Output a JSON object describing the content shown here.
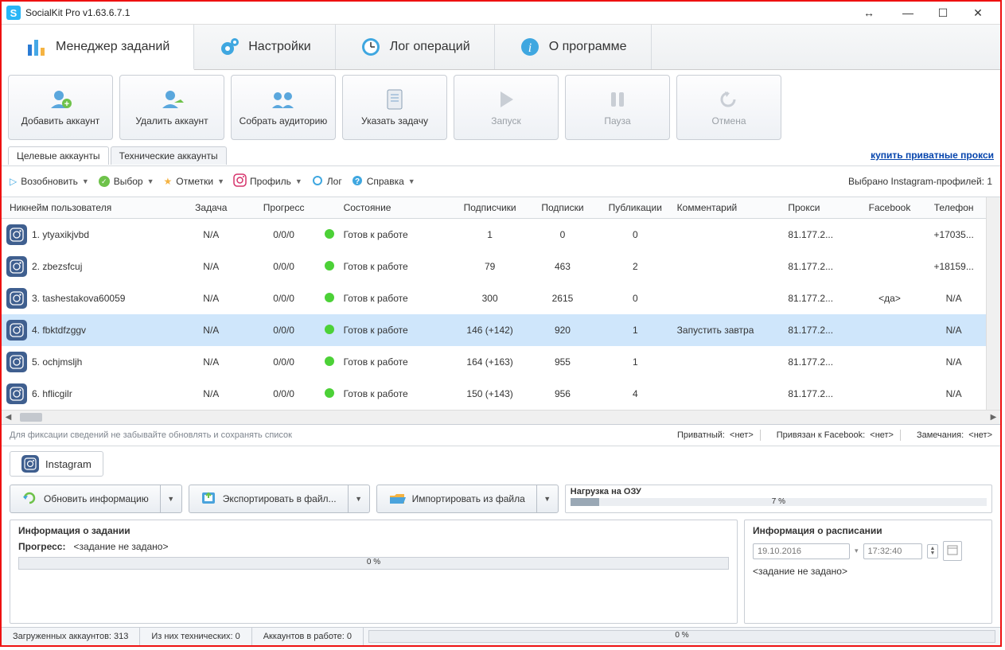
{
  "window": {
    "title": "SocialKit Pro v1.63.6.7.1"
  },
  "main_tabs": {
    "task_manager": "Менеджер заданий",
    "settings": "Настройки",
    "log": "Лог операций",
    "about": "О программе"
  },
  "big_buttons": {
    "add_account": "Добавить аккаунт",
    "delete_account": "Удалить аккаунт",
    "collect_audience": "Собрать аудиторию",
    "set_task": "Указать задачу",
    "start": "Запуск",
    "pause": "Пауза",
    "cancel": "Отмена"
  },
  "sub_tabs": {
    "target": "Целевые аккаунты",
    "tech": "Технические аккаунты"
  },
  "buy_proxy": "купить приватные прокси",
  "small_toolbar": {
    "resume": "Возобновить",
    "select": "Выбор",
    "marks": "Отметки",
    "profile": "Профиль",
    "log": "Лог",
    "help": "Справка",
    "right": "Выбрано Instagram-профилей: 1"
  },
  "columns": {
    "nick": "Никнейм пользователя",
    "task": "Задача",
    "progress": "Прогресс",
    "state": "Состояние",
    "followers": "Подписчики",
    "following": "Подписки",
    "posts": "Публикации",
    "comment": "Комментарий",
    "proxy": "Прокси",
    "facebook": "Facebook",
    "phone": "Телефон"
  },
  "rows": [
    {
      "n": "1. ytyaxikjvbd",
      "task": "N/A",
      "prog": "0/0/0",
      "state": "Готов к работе",
      "fol": "1",
      "sub": "0",
      "pub": "0",
      "com": "",
      "proxy": "81.177.2...",
      "fb": "",
      "ph": "+17035..."
    },
    {
      "n": "2. zbezsfcuj",
      "task": "N/A",
      "prog": "0/0/0",
      "state": "Готов к работе",
      "fol": "79",
      "sub": "463",
      "pub": "2",
      "com": "",
      "proxy": "81.177.2...",
      "fb": "",
      "ph": "+18159..."
    },
    {
      "n": "3. tashestakova60059",
      "task": "N/A",
      "prog": "0/0/0",
      "state": "Готов к работе",
      "fol": "300",
      "sub": "2615",
      "pub": "0",
      "com": "",
      "proxy": "81.177.2...",
      "fb": "<да>",
      "ph": "N/A"
    },
    {
      "n": "4. fbktdfzggv",
      "task": "N/A",
      "prog": "0/0/0",
      "state": "Готов к работе",
      "fol": "146 (+142)",
      "sub": "920",
      "pub": "1",
      "com": "Запустить завтра",
      "proxy": "81.177.2...",
      "fb": "",
      "ph": "N/A",
      "selected": true
    },
    {
      "n": "5. ochjmsljh",
      "task": "N/A",
      "prog": "0/0/0",
      "state": "Готов к работе",
      "fol": "164 (+163)",
      "sub": "955",
      "pub": "1",
      "com": "",
      "proxy": "81.177.2...",
      "fb": "",
      "ph": "N/A"
    },
    {
      "n": "6. hflicgilr",
      "task": "N/A",
      "prog": "0/0/0",
      "state": "Готов к работе",
      "fol": "150 (+143)",
      "sub": "956",
      "pub": "4",
      "com": "",
      "proxy": "81.177.2...",
      "fb": "",
      "ph": "N/A"
    }
  ],
  "hint": {
    "left": "Для фиксации сведений не забывайте обновлять и сохранять список",
    "private_lbl": "Приватный:",
    "private_val": "<нет>",
    "fb_lbl": "Привязан к Facebook:",
    "fb_val": "<нет>",
    "notes_lbl": "Замечания:",
    "notes_val": "<нет>"
  },
  "ig_tab": "Instagram",
  "actions": {
    "refresh": "Обновить информацию",
    "export": "Экспортировать в файл...",
    "import": "Импортировать из файла"
  },
  "ram": {
    "label": "Нагрузка на ОЗУ",
    "text": "7 %"
  },
  "task_panel": {
    "header": "Информация о задании",
    "progress_lbl": "Прогресс:",
    "progress_val": "<задание не задано>",
    "bar_text": "0 %"
  },
  "sched_panel": {
    "header": "Информация о расписании",
    "date": "19.10.2016",
    "time": "17:32:40",
    "empty": "<задание не задано>"
  },
  "status": {
    "loaded": "Загруженных аккаунтов: 313",
    "tech": "Из них технических: 0",
    "working": "Аккаунтов в работе: 0",
    "bar": "0 %"
  }
}
